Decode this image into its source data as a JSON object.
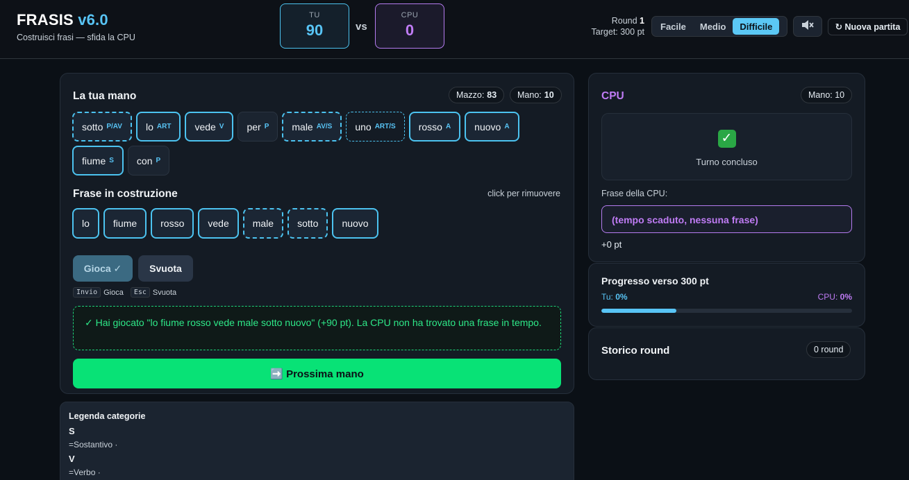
{
  "header": {
    "title": "FRASIS",
    "version": "v6.0",
    "subtitle": "Costruisci frasi — sfida la CPU",
    "you_label": "TU",
    "you_score": "90",
    "vs": "vs",
    "cpu_label": "CPU",
    "cpu_score": "0",
    "round_label": "Round",
    "round_value": "1",
    "target": "Target: 300 pt",
    "difficulty": [
      "Facile",
      "Medio",
      "Difficile"
    ],
    "difficulty_selected": "Difficile",
    "sound_icon": "speaker-muted-icon",
    "new_game": "↻ Nuova partita"
  },
  "hand": {
    "title": "La tua mano",
    "deck_label": "Mazzo:",
    "deck_count": "83",
    "hand_label": "Mano:",
    "hand_count": "10",
    "tiles": [
      {
        "word": "sotto",
        "cat": "P/AV"
      },
      {
        "word": "lo",
        "cat": "ART"
      },
      {
        "word": "vede",
        "cat": "V"
      },
      {
        "word": "per",
        "cat": "P"
      },
      {
        "word": "male",
        "cat": "AV/S"
      },
      {
        "word": "uno",
        "cat": "ART/S"
      },
      {
        "word": "rosso",
        "cat": "A"
      },
      {
        "word": "nuovo",
        "cat": "A"
      },
      {
        "word": "fiume",
        "cat": "S"
      },
      {
        "word": "con",
        "cat": "P"
      }
    ]
  },
  "sentence": {
    "title": "Frase in costruzione",
    "hint": "click per rimuovere",
    "words": [
      "lo",
      "fiume",
      "rosso",
      "vede",
      "male",
      "sotto",
      "nuovo"
    ]
  },
  "actions": {
    "play": "Gioca ✓",
    "clear": "Svuota",
    "kbd_enter": "Invio",
    "kbd_enter_label": "Gioca",
    "kbd_esc": "Esc",
    "kbd_esc_label": "Svuota"
  },
  "result": {
    "message": "✓ Hai giocato \"lo fiume rosso vede male sotto nuovo\" (+90 pt). La CPU non ha trovato una frase in tempo."
  },
  "next_hand": "➡️ Prossima mano",
  "legend": {
    "title": "Legenda categorie",
    "items": [
      {
        "key": "S",
        "desc": "=Sostantivo ·"
      },
      {
        "key": "V",
        "desc": "=Verbo ·"
      }
    ]
  },
  "cpu": {
    "title": "CPU",
    "hand_label": "Mano: 10",
    "status_icon": "check-mark-icon",
    "status_text": "Turno concluso",
    "phrase_label": "Frase della CPU:",
    "phrase": "(tempo scaduto, nessuna frase)",
    "points": "+0 pt"
  },
  "progress": {
    "title": "Progresso verso 300 pt",
    "you_label": "Tu:",
    "you_pct": "0%",
    "cpu_label": "CPU:",
    "cpu_pct": "0%",
    "you_fill": 0.3
  },
  "history": {
    "title": "Storico round",
    "count": "0 round"
  },
  "colors": {
    "accent": "#58c4f5",
    "cpu": "#c07cf5",
    "success": "#08e276"
  }
}
